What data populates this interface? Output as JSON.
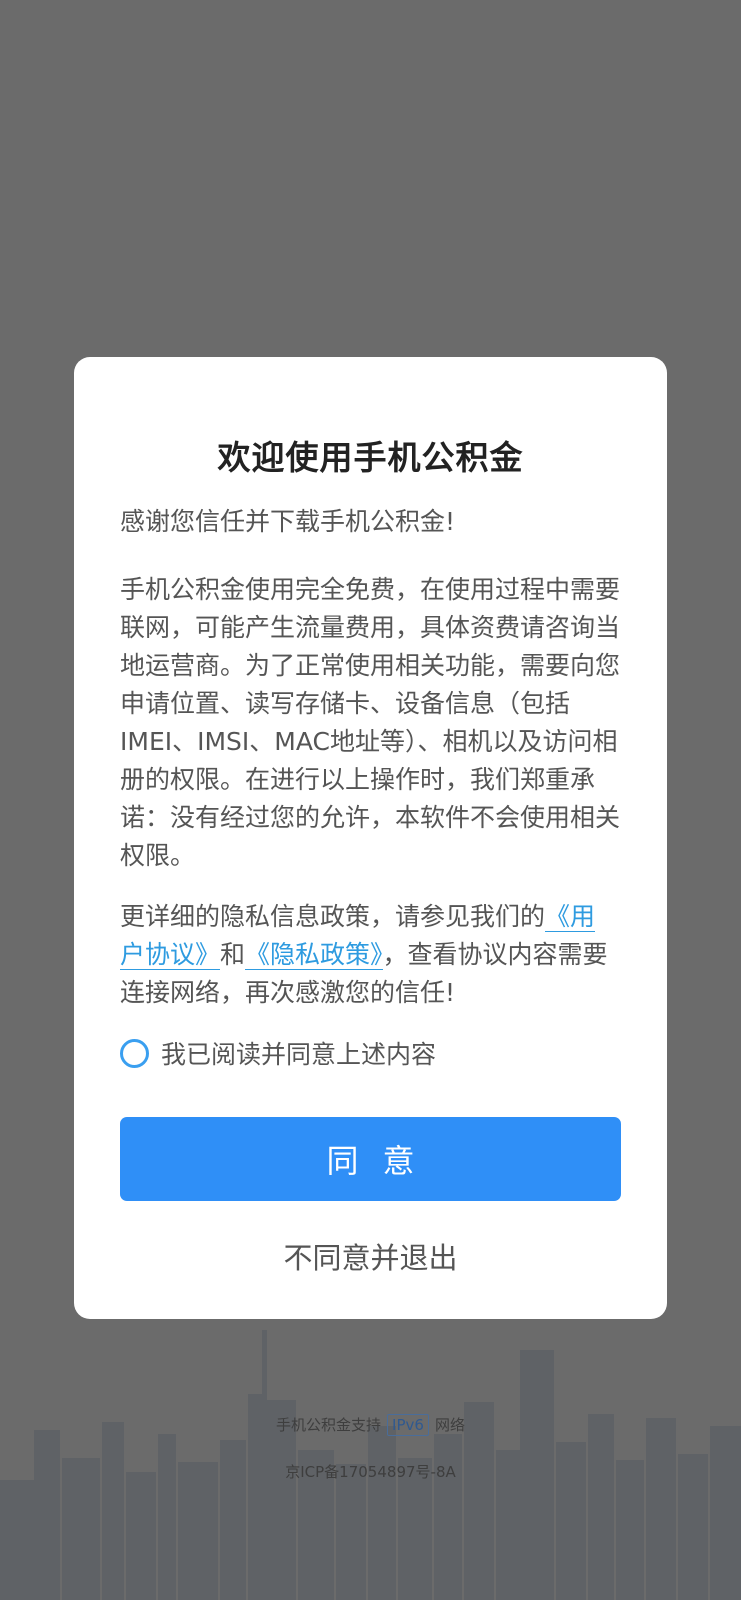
{
  "footer": {
    "support_prefix": "手机公积金支持",
    "ipv6_badge": "IPv6",
    "support_suffix": "网络",
    "icp": "京ICP备17054897号-8A"
  },
  "dialog": {
    "title": "欢迎使用手机公积金",
    "thanks": "感谢您信任并下载手机公积金!",
    "body": "手机公积金使用完全免费，在使用过程中需要联网，可能产生流量费用，具体资费请咨询当地运营商。为了正常使用相关功能，需要向您申请位置、读写存储卡、设备信息（包括IMEI、IMSI、MAC地址等）、相机以及访问相册的权限。在进行以上操作时，我们郑重承诺：没有经过您的允许，本软件不会使用相关权限。",
    "privacy_prefix": "更详细的隐私信息政策，请参见我们的",
    "user_agreement_link": "《用户协议》",
    "and_text": "和",
    "privacy_policy_link": "《隐私政策》",
    "privacy_suffix": "，查看协议内容需要连接网络，再次感激您的信任!",
    "consent_label": "我已阅读并同意上述内容",
    "agree_button": "同意",
    "disagree_button": "不同意并退出"
  },
  "colors": {
    "overlay": "#6b6b6b",
    "accent": "#2f8ff7",
    "link": "#2e9be0"
  }
}
